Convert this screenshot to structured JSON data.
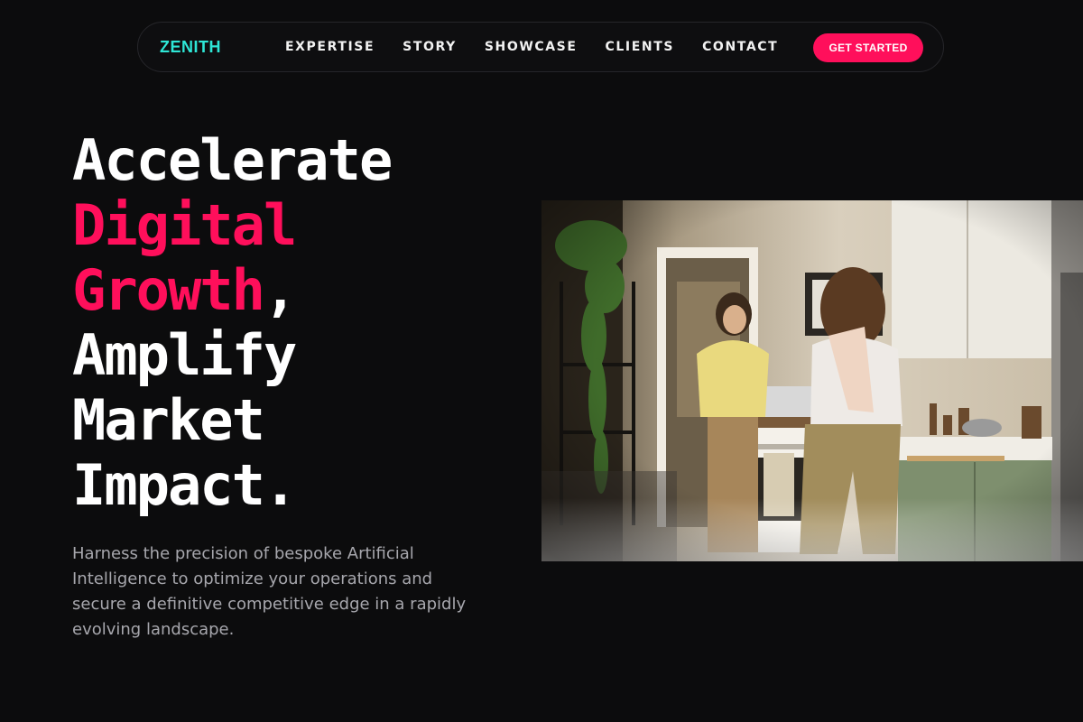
{
  "nav": {
    "logo": "ZENITH",
    "links": [
      "EXPERTISE",
      "STORY",
      "SHOWCASE",
      "CLIENTS",
      "CONTACT"
    ],
    "cta": "GET STARTED"
  },
  "hero": {
    "line1": "Accelerate",
    "line2": "Digital",
    "line3_accent": "Growth",
    "line3_rest": ",",
    "line4": "Amplify",
    "line5": "Market",
    "line6": "Impact.",
    "description": "Harness the precision of bespoke Artificial Intelligence to optimize your operations and secure a definitive competitive edge in a rapidly evolving landscape."
  },
  "colors": {
    "background": "#0c0c0d",
    "accent": "#ff0f5b",
    "logo": "#2ee6d6"
  }
}
